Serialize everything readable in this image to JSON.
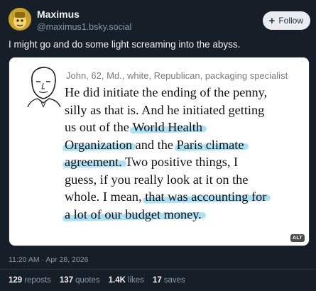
{
  "author": {
    "display_name": "Maximus",
    "handle": "@maximus1.bsky.social",
    "avatar_icon": "yellow-character-avatar"
  },
  "follow_button": {
    "label": "Follow",
    "icon": "plus-icon"
  },
  "post": {
    "text": "I might go and do some light screaming into the abyss.",
    "timestamp": "11:20 AM · Apr 28, 2026"
  },
  "embed": {
    "attribution": "John, 62, Md., white, Republican, packaging specialist",
    "quote_lines": [
      "He did initiate the ending of the penny,",
      "silly as that is. And he initiated getting",
      "us out of the ",
      "World Health",
      "Organization",
      " and the ",
      "Paris climate",
      "agreement.",
      " Two positive things, I",
      "guess, if you really look at it on the",
      "whole. I mean, ",
      "that was accounting for",
      "a lot of our budget money."
    ],
    "alt_badge": "ALT",
    "highlight_color": "#68c8ec"
  },
  "stats": {
    "reposts_count": "129",
    "reposts_label": "reposts",
    "quotes_count": "137",
    "quotes_label": "quotes",
    "likes_count": "1.4K",
    "likes_label": "likes",
    "saves_count": "17",
    "saves_label": "saves"
  },
  "colors": {
    "background": "#161e27",
    "text": "#f1f3f5",
    "muted": "#8b98a8",
    "follow_bg": "#e9edf1"
  }
}
